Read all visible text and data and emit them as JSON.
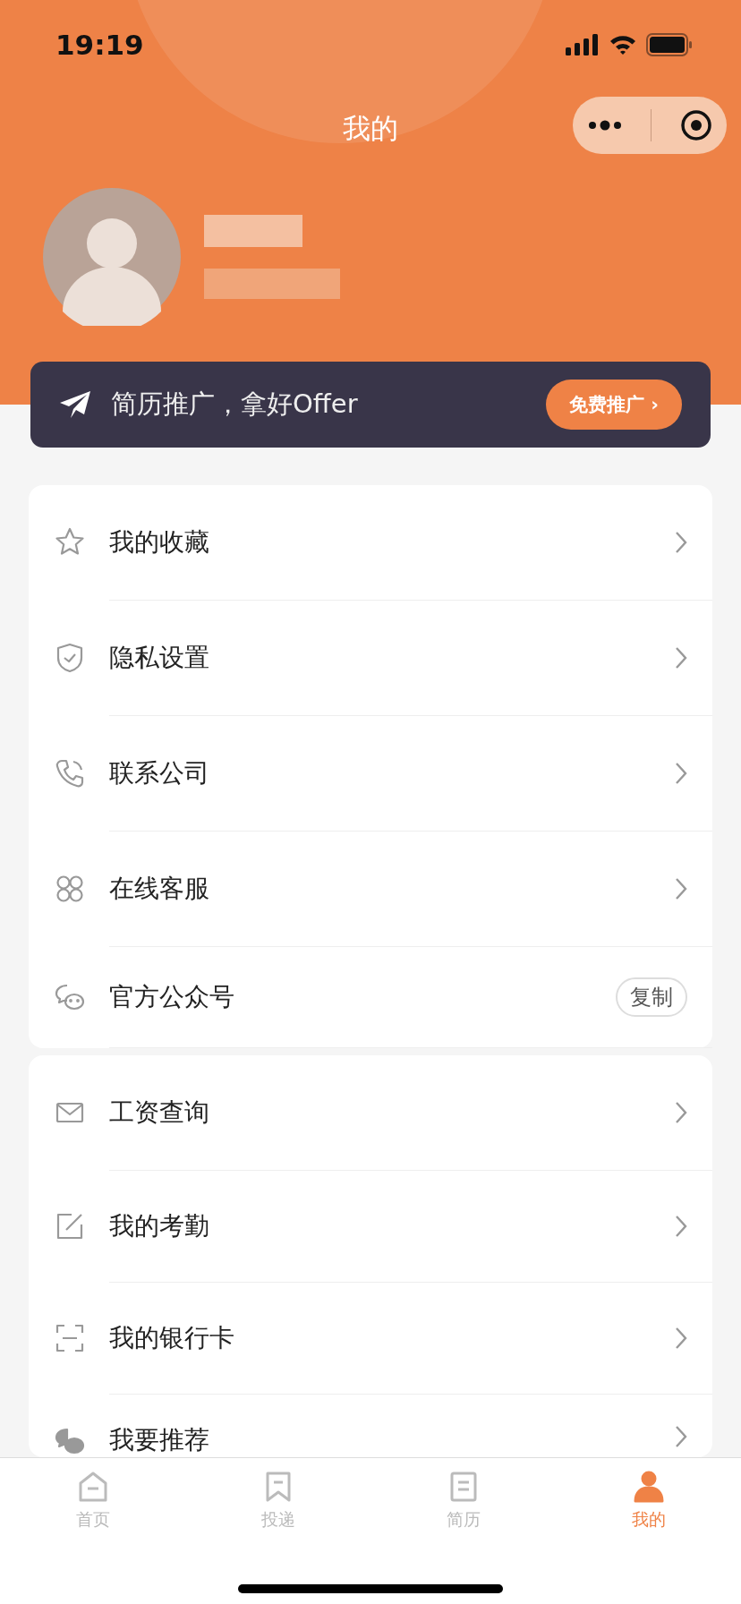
{
  "status_bar": {
    "time": "19:19"
  },
  "nav": {
    "title": "我的"
  },
  "banner": {
    "text": "简历推广，拿好Offer",
    "button": "免费推广",
    "chevron": "›"
  },
  "menu_groups": [
    {
      "items": [
        {
          "label": "我的收藏",
          "kind": "chevron"
        },
        {
          "label": "隐私设置",
          "kind": "chevron"
        },
        {
          "label": "联系公司",
          "kind": "chevron"
        },
        {
          "label": "在线客服",
          "kind": "chevron"
        },
        {
          "label": "官方公众号",
          "kind": "copy",
          "action": "复制"
        }
      ]
    },
    {
      "items": [
        {
          "label": "工资查询",
          "kind": "chevron"
        },
        {
          "label": "我的考勤",
          "kind": "chevron"
        },
        {
          "label": "我的银行卡",
          "kind": "chevron"
        },
        {
          "label": "我要推荐",
          "kind": "chevron"
        }
      ]
    }
  ],
  "tabs": [
    {
      "label": "首页",
      "selected": false
    },
    {
      "label": "投递",
      "selected": false
    },
    {
      "label": "简历",
      "selected": false
    },
    {
      "label": "我的",
      "selected": true
    }
  ]
}
